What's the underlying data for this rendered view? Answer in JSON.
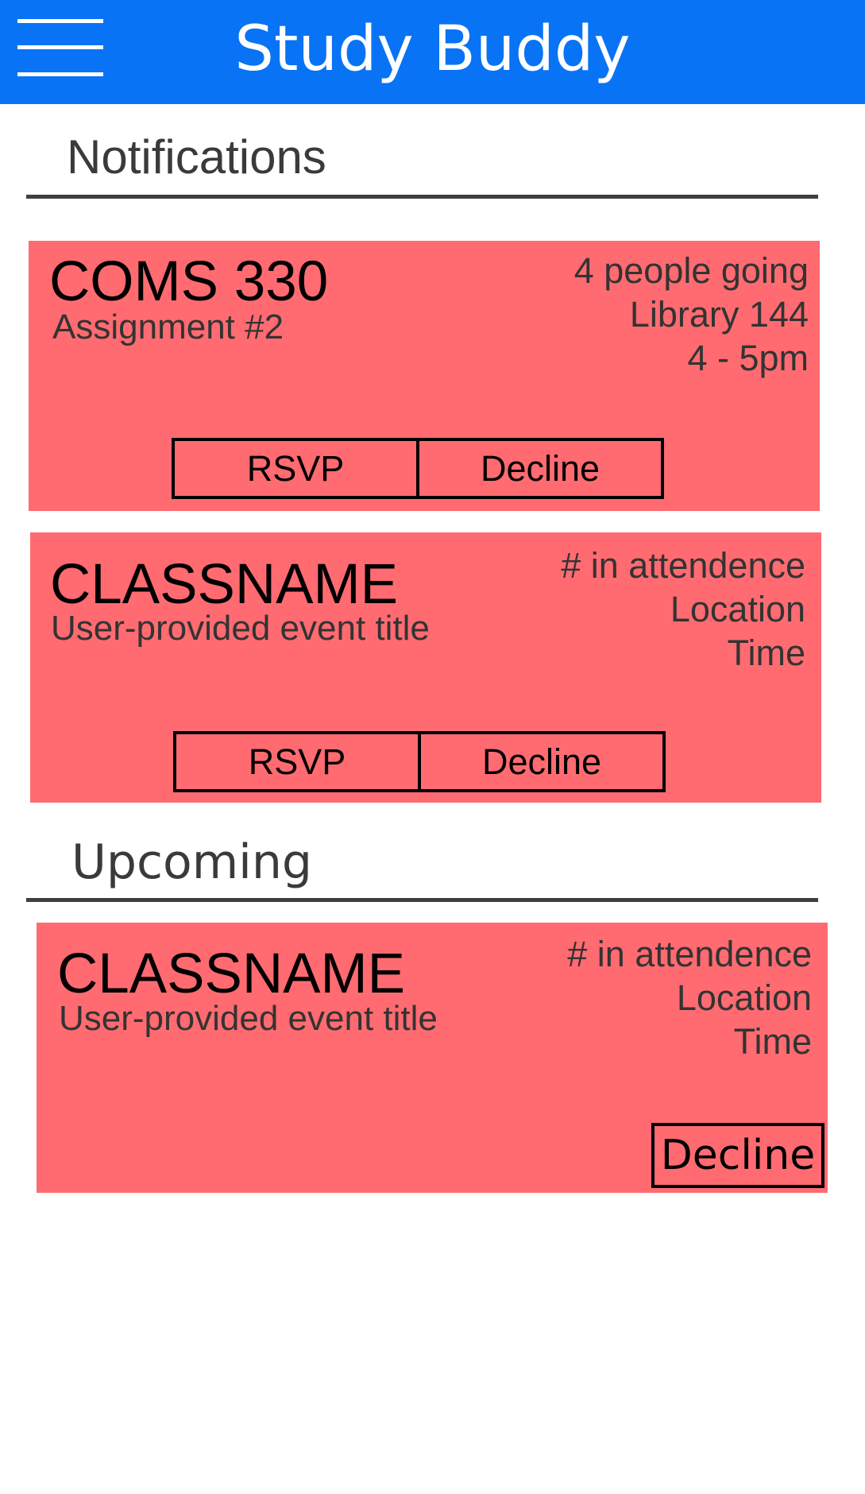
{
  "header": {
    "title": "Study Buddy",
    "menu_icon": "hamburger-menu-icon",
    "background_color": "#0873f5"
  },
  "sections": {
    "notifications_title": "Notifications",
    "upcoming_title": "Upcoming"
  },
  "card_color": "#ff6b70",
  "notifications": [
    {
      "class_name": "COMS 330",
      "event_title": "Assignment #2",
      "attendance": "4 people going",
      "location": "Library 144",
      "time": "4 - 5pm",
      "rsvp_label": "RSVP",
      "decline_label": "Decline"
    },
    {
      "class_name": "CLASSNAME",
      "event_title": "User-provided event title",
      "attendance": "# in attendence",
      "location": "Location",
      "time": "Time",
      "rsvp_label": "RSVP",
      "decline_label": "Decline"
    }
  ],
  "upcoming": [
    {
      "class_name": "CLASSNAME",
      "event_title": "User-provided event title",
      "attendance": "# in attendence",
      "location": "Location",
      "time": "Time",
      "decline_label": "Decline"
    }
  ]
}
